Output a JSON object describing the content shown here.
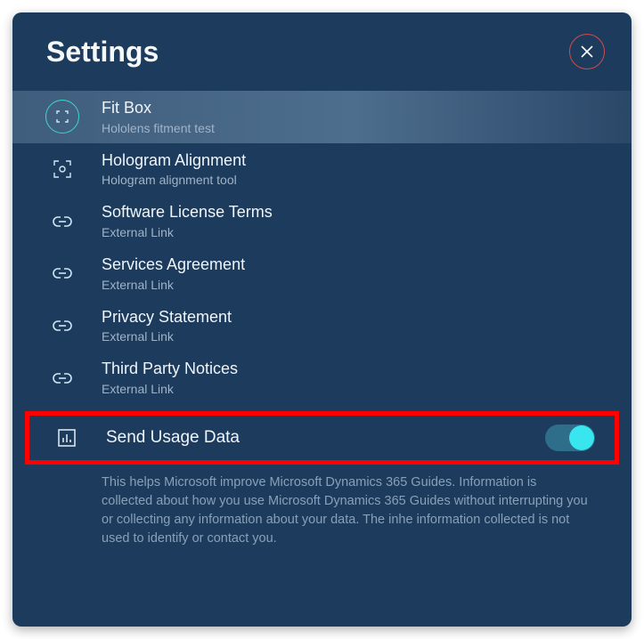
{
  "header": {
    "title": "Settings"
  },
  "items": [
    {
      "title": "Fit Box",
      "sub": "Hololens fitment test"
    },
    {
      "title": "Hologram Alignment",
      "sub": "Hologram alignment tool"
    },
    {
      "title": "Software License Terms",
      "sub": "External Link"
    },
    {
      "title": "Services Agreement",
      "sub": "External Link"
    },
    {
      "title": "Privacy Statement",
      "sub": "External Link"
    },
    {
      "title": "Third Party Notices",
      "sub": "External Link"
    }
  ],
  "usage": {
    "title": "Send Usage Data",
    "enabled": true,
    "help": "This helps Microsoft improve Microsoft Dynamics 365 Guides.  Information is collected about how you use Microsoft Dynamics 365 Guides without interrupting you or collecting any information about your data.  The inhe information collected is not used to identify or contact you."
  }
}
